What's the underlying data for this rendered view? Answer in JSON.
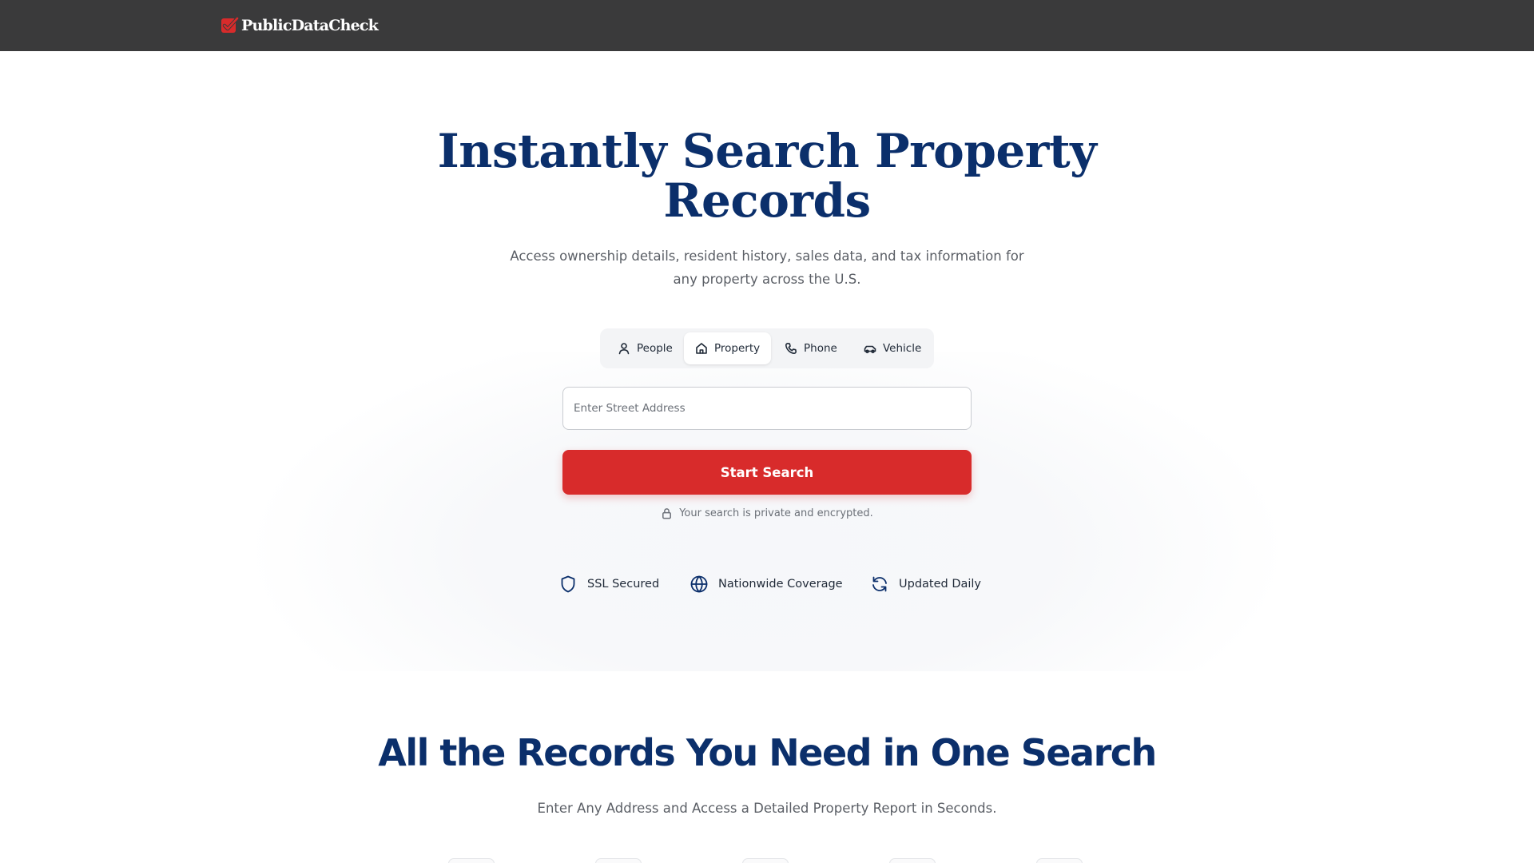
{
  "header": {
    "logo_text": "PublicDataCheck",
    "logo_icon": "red-checkbox-icon"
  },
  "hero": {
    "title": "Instantly Search Property Records",
    "subtitle": "Access ownership details, resident history, sales data, and tax information for any property across the U.S."
  },
  "search_tabs": [
    {
      "label": "People",
      "icon": "person-icon",
      "active": false
    },
    {
      "label": "Property",
      "icon": "house-icon",
      "active": true
    },
    {
      "label": "Phone",
      "icon": "phone-icon",
      "active": false
    },
    {
      "label": "Vehicle",
      "icon": "car-icon",
      "active": false
    }
  ],
  "search": {
    "placeholder": "Enter Street Address",
    "value": "",
    "button_label": "Start Search",
    "privacy_note": "Your search is private and encrypted."
  },
  "trust_badges": [
    {
      "label": "SSL Secured",
      "icon": "shield-icon"
    },
    {
      "label": "Nationwide Coverage",
      "icon": "globe-icon"
    },
    {
      "label": "Updated Daily",
      "icon": "refresh-icon"
    }
  ],
  "records_section": {
    "title": "All the Records You Need in One Search",
    "subtitle": "Enter Any Address and Access a Detailed Property Report in Seconds."
  },
  "colors": {
    "header_bg": "#3a3a3b",
    "brand_navy": "#0b2f6b",
    "cta_red": "#d82b2b",
    "tab_bg": "#f3f4f6"
  }
}
